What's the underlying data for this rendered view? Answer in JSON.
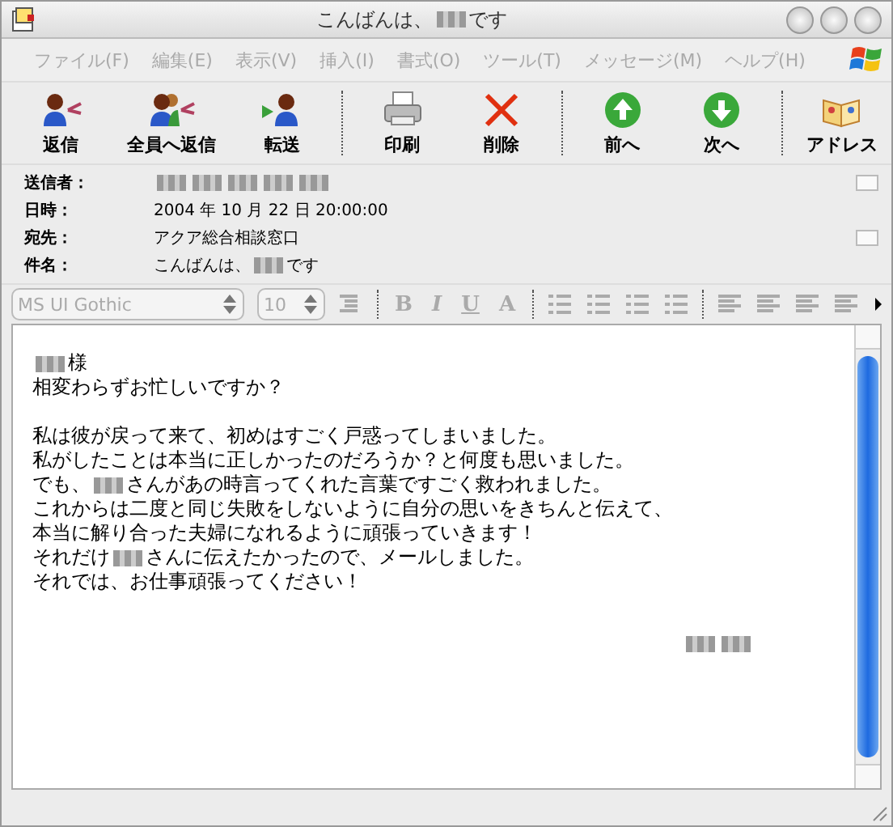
{
  "window": {
    "title": [
      {
        "kind": "text",
        "text": "こんばんは、"
      },
      {
        "kind": "redacted"
      },
      {
        "kind": "text",
        "text": "です"
      }
    ]
  },
  "menu": [
    {
      "label": "ファイル(F)",
      "disabled": true
    },
    {
      "label": "編集(E)",
      "disabled": true
    },
    {
      "label": "表示(V)",
      "disabled": true
    },
    {
      "label": "挿入(I)",
      "disabled": true
    },
    {
      "label": "書式(O)",
      "disabled": true
    },
    {
      "label": "ツール(T)",
      "disabled": true
    },
    {
      "label": "メッセージ(M)",
      "disabled": true
    },
    {
      "label": "ヘルプ(H)",
      "disabled": true
    }
  ],
  "toolbar": [
    {
      "kind": "reply",
      "label": "返信"
    },
    {
      "kind": "reply_all",
      "label": "全員へ返信"
    },
    {
      "kind": "forward",
      "label": "転送"
    },
    {
      "kind": "separator"
    },
    {
      "kind": "print",
      "label": "印刷"
    },
    {
      "kind": "delete",
      "label": "削除"
    },
    {
      "kind": "separator"
    },
    {
      "kind": "previous",
      "label": "前へ"
    },
    {
      "kind": "next",
      "label": "次へ"
    },
    {
      "kind": "separator"
    },
    {
      "kind": "address",
      "label": "アドレス"
    }
  ],
  "header": [
    {
      "label": "送信者：",
      "value": [
        {
          "kind": "redacted"
        },
        {
          "kind": "redacted"
        },
        {
          "kind": "redacted"
        },
        {
          "kind": "redacted"
        },
        {
          "kind": "redacted"
        }
      ],
      "expander": true
    },
    {
      "label": "日時：",
      "value": [
        {
          "kind": "text",
          "text": "2004 年 10 月 22 日 20:00:00"
        }
      ],
      "expander": false
    },
    {
      "label": "宛先：",
      "value": [
        {
          "kind": "text",
          "text": "アクア総合相談窓口"
        }
      ],
      "expander": true
    },
    {
      "label": "件名：",
      "value": [
        {
          "kind": "text",
          "text": "こんばんは、"
        },
        {
          "kind": "redacted"
        },
        {
          "kind": "text",
          "text": "です"
        }
      ],
      "expander": false
    }
  ],
  "format_bar": {
    "font": "MS UI Gothic",
    "size": "10",
    "buttons": [
      "B",
      "I",
      "U",
      "A"
    ]
  },
  "body": [
    {
      "kind": "line",
      "parts": [
        {
          "kind": "redacted"
        },
        {
          "kind": "text",
          "text": "様"
        }
      ]
    },
    {
      "kind": "line",
      "parts": [
        {
          "kind": "text",
          "text": "相変わらずお忙しいですか？"
        }
      ]
    },
    {
      "kind": "blank"
    },
    {
      "kind": "line",
      "parts": [
        {
          "kind": "text",
          "text": "私は彼が戻って来て、初めはすごく戸惑ってしまいました。"
        }
      ]
    },
    {
      "kind": "line",
      "parts": [
        {
          "kind": "text",
          "text": "私がしたことは本当に正しかったのだろうか？と何度も思いました。"
        }
      ]
    },
    {
      "kind": "line",
      "parts": [
        {
          "kind": "text",
          "text": "でも、"
        },
        {
          "kind": "redacted"
        },
        {
          "kind": "text",
          "text": "さんがあの時言ってくれた言葉ですごく救われました。"
        }
      ]
    },
    {
      "kind": "line",
      "parts": [
        {
          "kind": "text",
          "text": "これからは二度と同じ失敗をしないように自分の思いをきちんと伝えて、"
        }
      ]
    },
    {
      "kind": "line",
      "parts": [
        {
          "kind": "text",
          "text": "本当に解り合った夫婦になれるように頑張っていきます！"
        }
      ]
    },
    {
      "kind": "line",
      "parts": [
        {
          "kind": "text",
          "text": "それだけ"
        },
        {
          "kind": "redacted"
        },
        {
          "kind": "text",
          "text": "さんに伝えたかったので、メールしました。"
        }
      ]
    },
    {
      "kind": "line",
      "parts": [
        {
          "kind": "text",
          "text": "それでは、お仕事頑張ってください！"
        }
      ]
    }
  ],
  "signature": [
    {
      "kind": "redacted"
    },
    {
      "kind": "redacted"
    }
  ]
}
